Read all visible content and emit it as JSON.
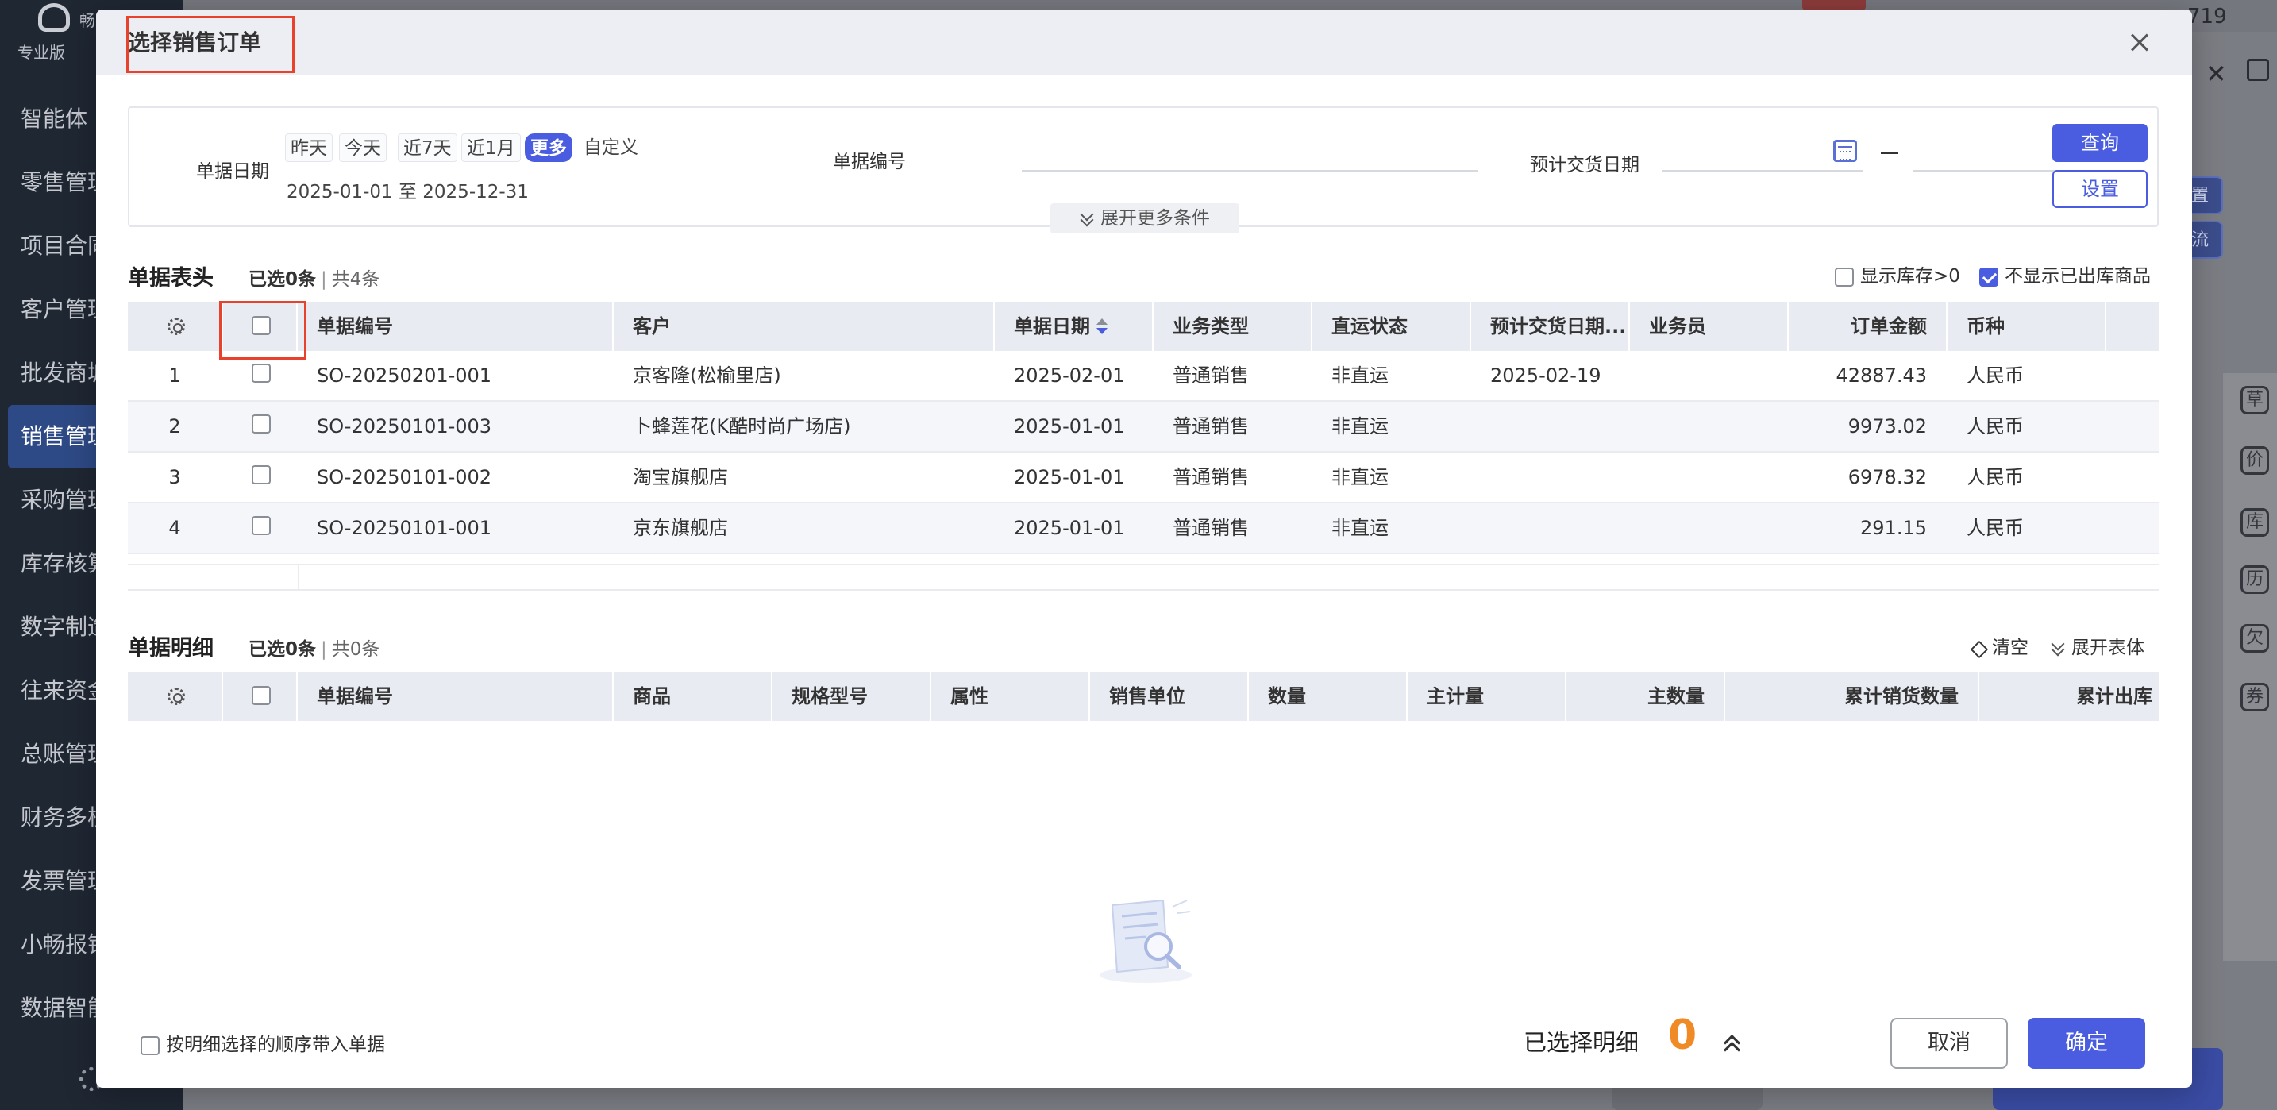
{
  "background": {
    "app_name": "畅",
    "edition": "专业版",
    "nav_items": [
      "智能体",
      "零售管理",
      "项目合同",
      "客户管理",
      "批发商城",
      "销售管理",
      "采购管理",
      "库存核算",
      "数字制造",
      "往来资金",
      "总账管理",
      "财务多核",
      "发票管理",
      "小畅报销",
      "数据智能"
    ],
    "active_nav_index": 5,
    "top_right_number": "719",
    "right_btn_settings": "设置",
    "right_btn_logistics": "物流",
    "right_tool_icons": [
      "草",
      "价",
      "库",
      "历",
      "欠",
      "券"
    ]
  },
  "modal": {
    "title": "选择销售订单",
    "filter": {
      "doc_date_label": "单据日期",
      "quick_dates": [
        "昨天",
        "今天",
        "近7天",
        "近1月",
        "更多",
        "自定义"
      ],
      "selected_quick_date_index": 4,
      "date_range_text": "2025-01-01 至 2025-12-31",
      "doc_no_label": "单据编号",
      "doc_no_value": "",
      "expected_delivery_label": "预计交货日期",
      "expected_delivery_from": "",
      "expected_delivery_to": "",
      "query_button": "查询",
      "settings_button": "设置",
      "expand_more": "展开更多条件"
    },
    "header_section": {
      "title": "单据表头",
      "selected_text": "已选0条",
      "total_text": "共4条",
      "show_stock_label": "显示库存>0",
      "show_stock_checked": false,
      "hide_outbound_label": "不显示已出库商品",
      "hide_outbound_checked": true,
      "columns": [
        "单据编号",
        "客户",
        "单据日期",
        "业务类型",
        "直运状态",
        "预计交货日期...",
        "业务员",
        "订单金额",
        "币种"
      ],
      "rows": [
        {
          "idx": "1",
          "doc_no": "SO-20250201-001",
          "customer": "京客隆(松榆里店)",
          "date": "2025-02-01",
          "biz_type": "普通销售",
          "direct": "非直运",
          "delivery": "2025-02-19",
          "salesman": "",
          "amount": "42887.43",
          "currency": "人民币"
        },
        {
          "idx": "2",
          "doc_no": "SO-20250101-003",
          "customer": "卜蜂莲花(K酷时尚广场店)",
          "date": "2025-01-01",
          "biz_type": "普通销售",
          "direct": "非直运",
          "delivery": "",
          "salesman": "",
          "amount": "9973.02",
          "currency": "人民币"
        },
        {
          "idx": "3",
          "doc_no": "SO-20250101-002",
          "customer": "淘宝旗舰店",
          "date": "2025-01-01",
          "biz_type": "普通销售",
          "direct": "非直运",
          "delivery": "",
          "salesman": "",
          "amount": "6978.32",
          "currency": "人民币"
        },
        {
          "idx": "4",
          "doc_no": "SO-20250101-001",
          "customer": "京东旗舰店",
          "date": "2025-01-01",
          "biz_type": "普通销售",
          "direct": "非直运",
          "delivery": "",
          "salesman": "",
          "amount": "291.15",
          "currency": "人民币"
        }
      ]
    },
    "detail_section": {
      "title": "单据明细",
      "selected_text": "已选0条",
      "total_text": "共0条",
      "clear_label": "清空",
      "expand_label": "展开表体",
      "columns": [
        "单据编号",
        "商品",
        "规格型号",
        "属性",
        "销售单位",
        "数量",
        "主计量",
        "主数量",
        "累计销货数量",
        "累计出库"
      ]
    },
    "footer": {
      "order_option_label": "按明细选择的顺序带入单据",
      "selected_detail_label": "已选择明细",
      "selected_detail_count": "0",
      "cancel_button": "取消",
      "ok_button": "确定"
    }
  },
  "colors": {
    "accent": "#4a5de0",
    "highlight": "#e8412c",
    "count": "#f08a24"
  }
}
